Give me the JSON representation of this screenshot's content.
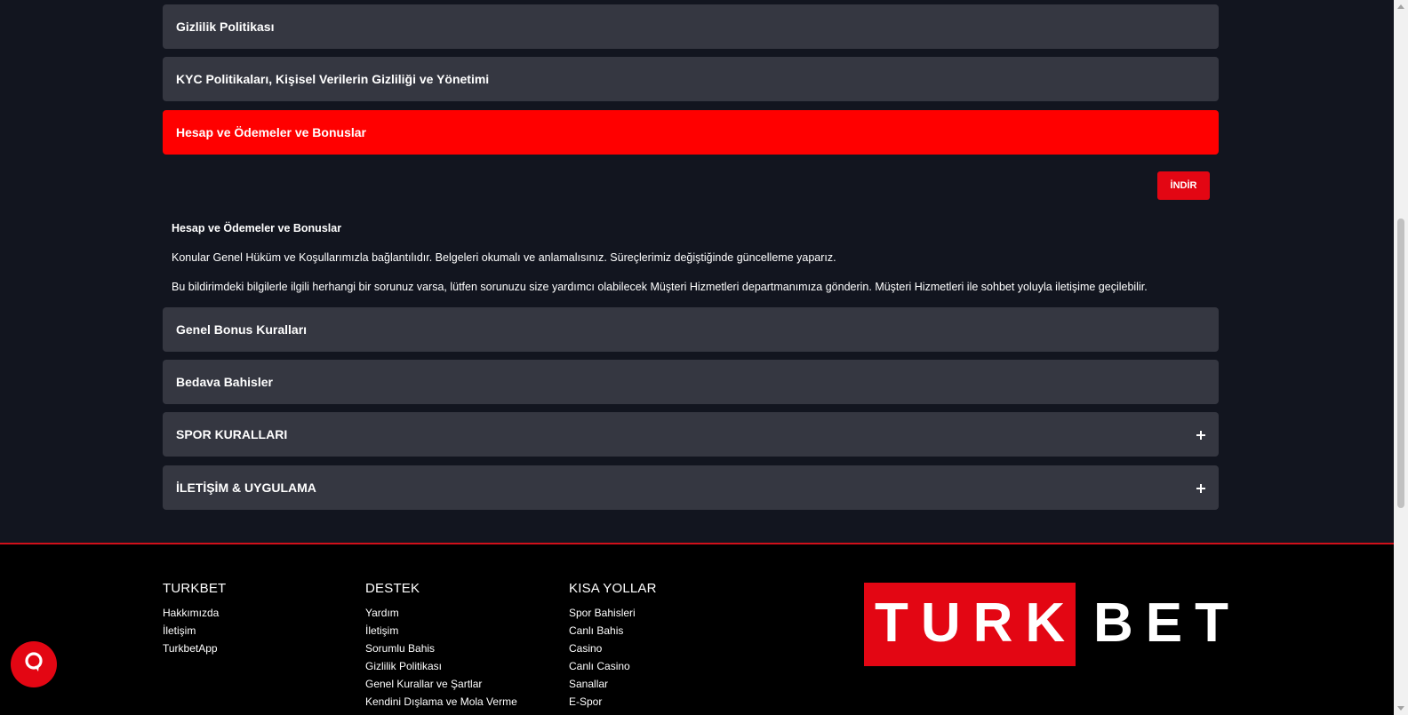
{
  "accordion": [
    {
      "label": "Gizlilik Politikası",
      "active": false,
      "has_plus": false
    },
    {
      "label": "KYC Politikaları, Kişisel Verilerin Gizliliği ve Yönetimi",
      "active": false,
      "has_plus": false
    },
    {
      "label": "Hesap ve Ödemeler ve Bonuslar",
      "active": true,
      "has_plus": false
    },
    {
      "label": "Genel Bonus Kuralları",
      "active": false,
      "has_plus": false
    },
    {
      "label": "Bedava Bahisler",
      "active": false,
      "has_plus": false
    },
    {
      "label": "SPOR KURALLARI",
      "active": false,
      "has_plus": true
    },
    {
      "label": "İLETİŞİM & UYGULAMA",
      "active": false,
      "has_plus": true
    }
  ],
  "expanded": {
    "download_label": "İNDİR",
    "title": "Hesap ve Ödemeler ve Bonuslar",
    "paragraph1": "Konular Genel Hüküm ve Koşullarımızla bağlantılıdır. Belgeleri okumalı ve anlamalısınız. Süreçlerimiz değiştiğinde güncelleme yaparız.",
    "paragraph2": "Bu bildirimdeki bilgilerle ilgili herhangi bir sorunuz varsa, lütfen sorunuzu size yardımcı olabilecek Müşteri Hizmetleri departmanımıza gönderin. Müşteri Hizmetleri ile sohbet yoluyla iletişime geçilebilir."
  },
  "accordion_icon": "plus-icon",
  "footer": {
    "columns": [
      {
        "title": "TURKBET",
        "links": [
          "Hakkımızda",
          "İletişim",
          "TurkbetApp"
        ]
      },
      {
        "title": "DESTEK",
        "links": [
          "Yardım",
          "İletişim",
          "Sorumlu Bahis",
          "Gizlilik Politikası",
          "Genel Kurallar ve Şartlar",
          "Kendini Dışlama ve Mola Verme"
        ]
      },
      {
        "title": "KISA YOLLAR",
        "links": [
          "Spor Bahisleri",
          "Canlı Bahis",
          "Casino",
          "Canlı Casino",
          "Sanallar",
          "E-Spor"
        ]
      }
    ],
    "logo_part1": "TURK",
    "logo_part2": "BET"
  },
  "chat_icon": "chat-bubble-icon",
  "colors": {
    "background": "#12151f",
    "accordion": "#353741",
    "active": "#ff0000",
    "brand_red": "#e30613",
    "footer_border": "#d0101a"
  }
}
